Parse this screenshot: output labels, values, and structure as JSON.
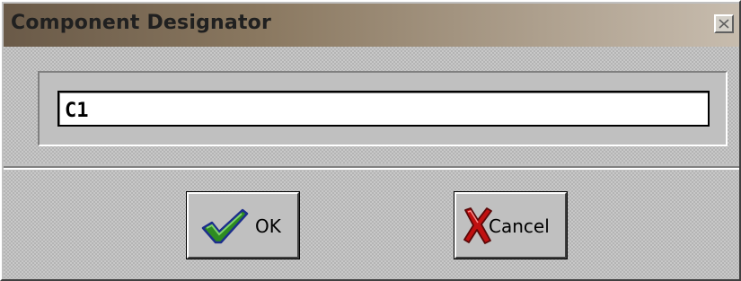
{
  "window": {
    "title": "Component Designator"
  },
  "designator_field": {
    "value": "C1"
  },
  "buttons": {
    "ok_label": "OK",
    "cancel_label": "Cancel"
  },
  "icons": {
    "close": "close-icon",
    "ok": "checkmark-icon",
    "cancel": "red-x-icon"
  },
  "colors": {
    "title_bar_dark": "#6a5a48",
    "title_bar_light": "#c7bcae",
    "face": "#c0c0c0",
    "checkmark_green": "#2e8b22",
    "checkmark_blue_edge": "#1c2e8c",
    "cancel_red": "#c01010"
  }
}
